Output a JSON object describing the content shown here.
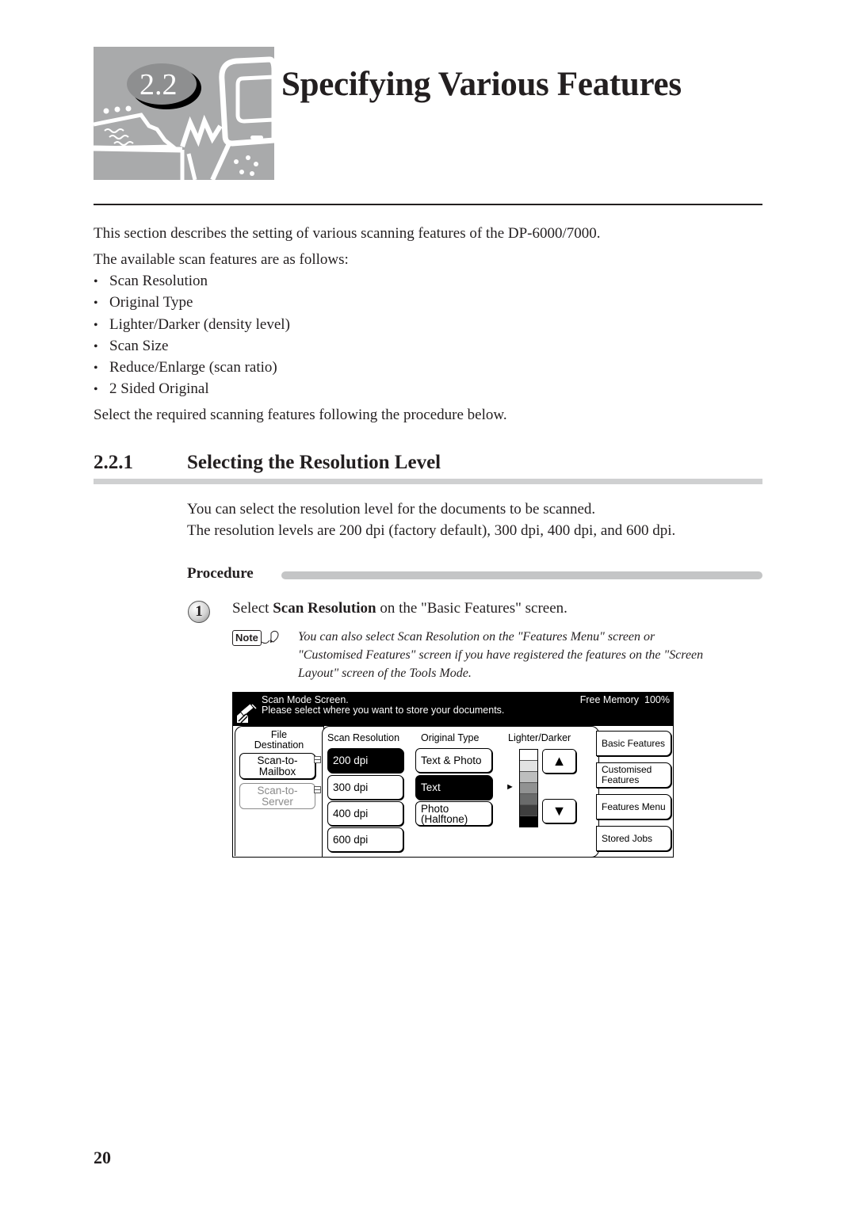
{
  "chapter": {
    "number": "2.2",
    "title": "Specifying Various Features"
  },
  "intro": {
    "p1": "This section describes the setting of various scanning features of the DP-6000/7000.",
    "p2": "The available scan features are as follows:",
    "features": [
      "Scan Resolution",
      "Original Type",
      "Lighter/Darker (density level)",
      "Scan Size",
      "Reduce/Enlarge (scan ratio)",
      "2 Sided Original"
    ],
    "bullet": "•",
    "p3": "Select the required scanning features following the procedure below."
  },
  "section": {
    "number": "2.2.1",
    "title": "Selecting the Resolution Level",
    "p1": "You can select the resolution level for the documents to be scanned.",
    "p2": "The resolution levels are 200 dpi (factory default), 300 dpi, 400 dpi, and 600 dpi."
  },
  "procedure": {
    "label": "Procedure",
    "step": {
      "number": "1",
      "text_before": "Select ",
      "text_bold": "Scan Resolution",
      "text_after": " on the \"Basic Features\" screen."
    },
    "note": {
      "label": "Note",
      "lines": [
        "You can also select Scan Resolution on the \"Features Menu\" screen or",
        "\"Customised Features\" screen if you have registered the features on the \"Screen",
        "Layout\" screen of the Tools Mode."
      ]
    }
  },
  "panel": {
    "message1": "Scan Mode Screen.",
    "message2": "Please select where you want to store your documents.",
    "free_memory_label": "Free Memory",
    "free_memory_value": "100%",
    "file_destination": {
      "label": "File Destination",
      "label_line1": "File",
      "label_line2": "Destination",
      "options": [
        {
          "line1": "Scan-to-",
          "line2": "Mailbox",
          "enabled": true
        },
        {
          "line1": "Scan-to-",
          "line2": "Server",
          "enabled": false
        }
      ]
    },
    "scan_resolution": {
      "label": "Scan Resolution",
      "options": [
        "200 dpi",
        "300 dpi",
        "400 dpi",
        "600 dpi"
      ],
      "selected": "200 dpi"
    },
    "original_type": {
      "label": "Original Type",
      "options": [
        {
          "line1": "Text & Photo",
          "line2": ""
        },
        {
          "line1": "Text",
          "line2": ""
        },
        {
          "line1": "Photo",
          "line2": "(Halftone)"
        }
      ],
      "selected": "Text"
    },
    "lighter_darker": {
      "label": "Lighter/Darker",
      "levels": 7,
      "current_level": 4,
      "level_colors": [
        "#ffffff",
        "#e2e3e3",
        "#bdbebe",
        "#919292",
        "#6a6b6b",
        "#3f3f3f",
        "#000000"
      ],
      "marker": "►",
      "up": "▲",
      "down": "▼"
    },
    "side_menu": [
      {
        "line1": "Basic Features",
        "line2": ""
      },
      {
        "line1": "Customised",
        "line2": "Features"
      },
      {
        "line1": "Features Menu",
        "line2": ""
      },
      {
        "line1": "Stored Jobs",
        "line2": ""
      }
    ]
  },
  "page_number": "20"
}
